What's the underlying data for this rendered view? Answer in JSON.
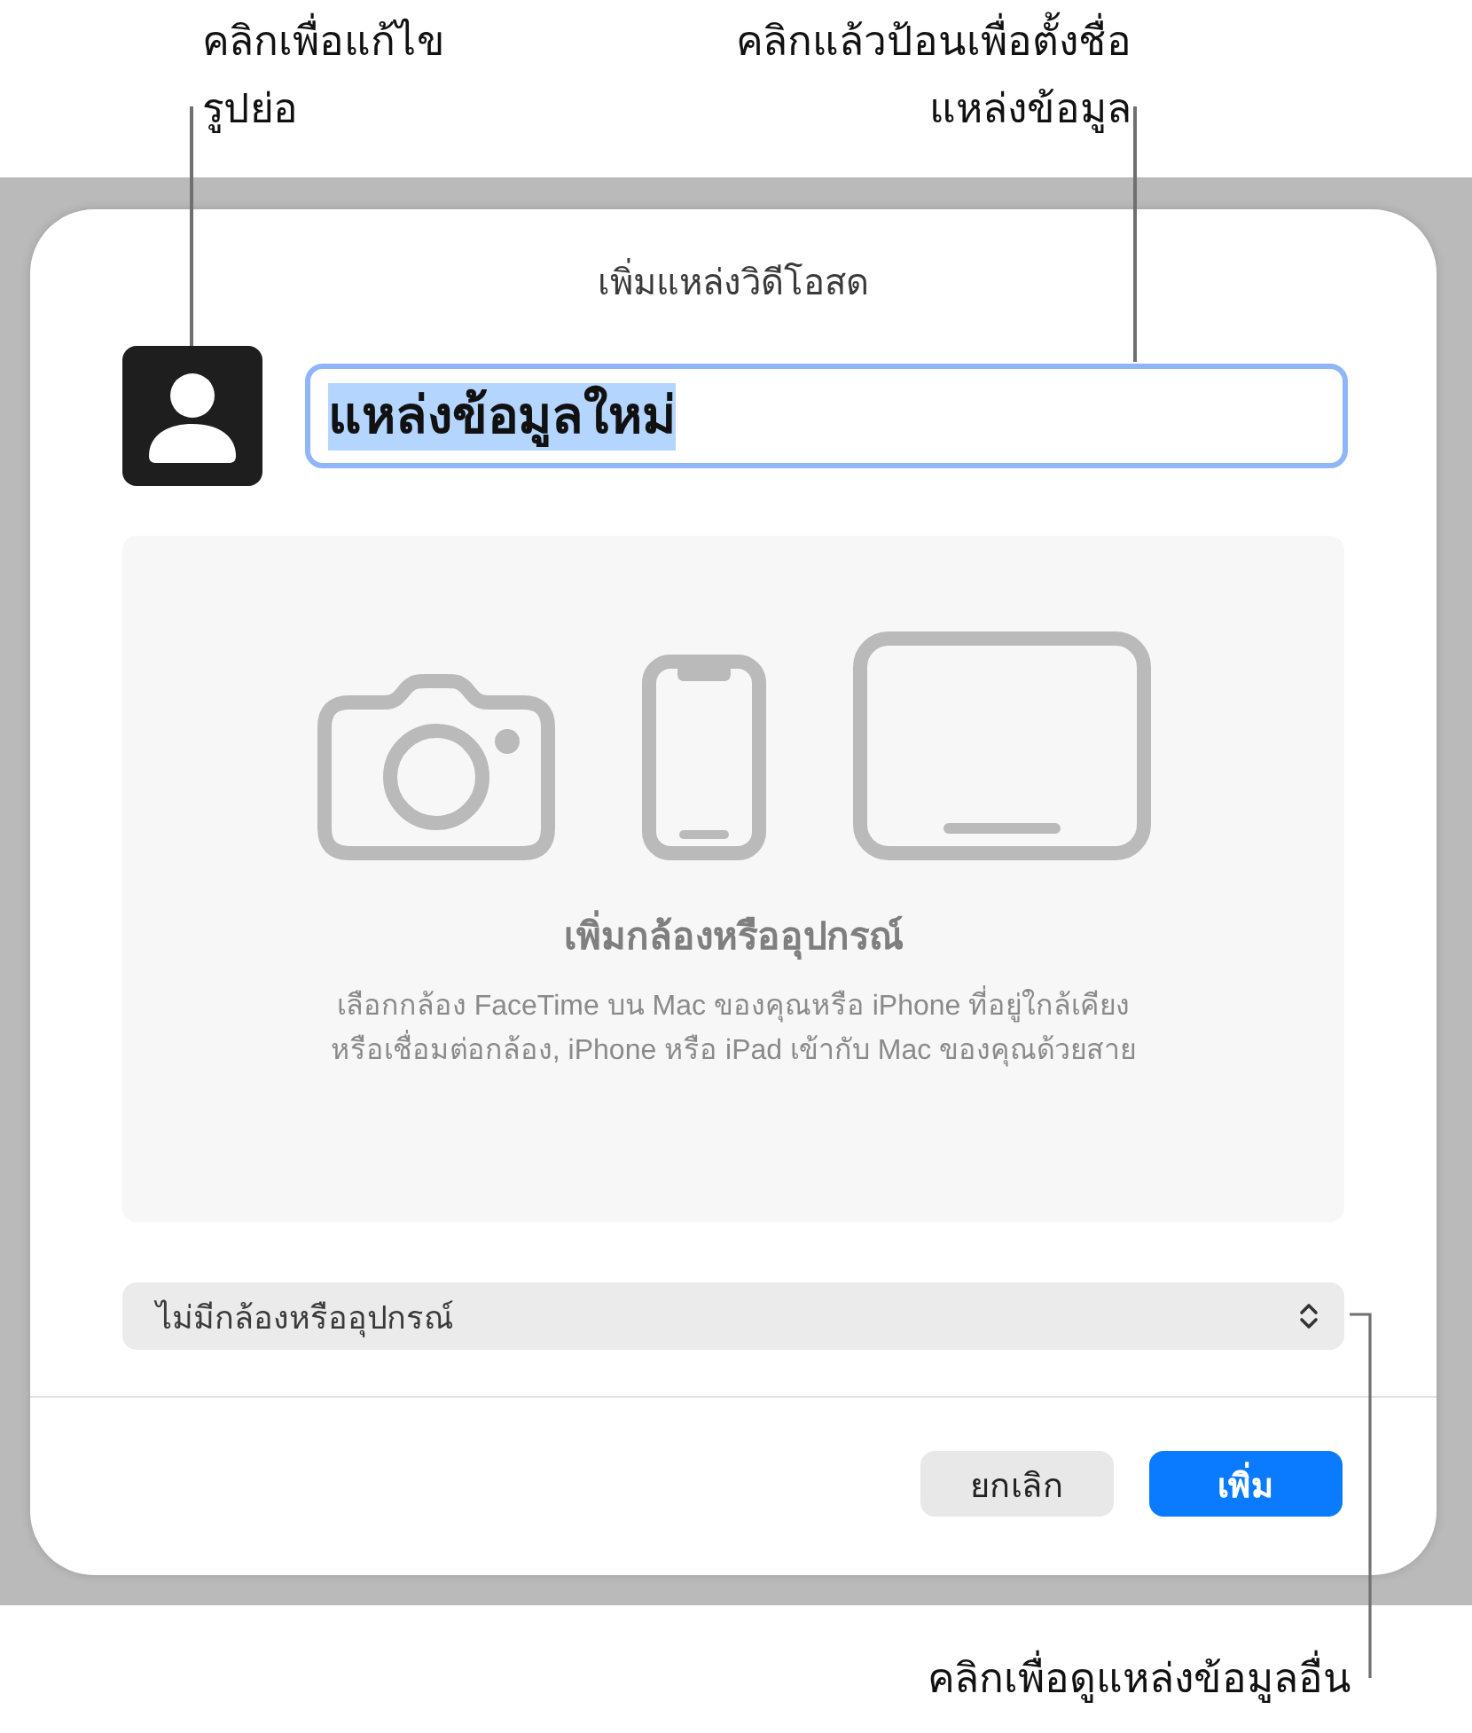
{
  "callouts": [
    {
      "text": "คลิกเพื่อแก้ไข\nรูปย่อ"
    },
    {
      "text": "คลิกแล้วป้อนเพื่อตั้งชื่อ\nแหล่งข้อมูล"
    },
    {
      "text": "คลิกเพื่อดูแหล่งข้อมูลอื่น"
    }
  ],
  "dialog": {
    "title": "เพิ่มแหล่งวิดีโอสด",
    "name_field": {
      "value": "แหล่งข้อมูลใหม่",
      "focused": true,
      "text_selected": true
    },
    "device_panel": {
      "heading": "เพิ่มกล้องหรืออุปกรณ์",
      "description": "เลือกกล้อง FaceTime บน Mac ของคุณหรือ iPhone ที่อยู่ใกล้เคียง\nหรือเชื่อมต่อกล้อง, iPhone หรือ iPad เข้ากับ Mac ของคุณด้วยสาย"
    },
    "source_popup": {
      "value": "ไม่มีกล้องหรืออุปกรณ์"
    },
    "buttons": [
      {
        "label": "ยกเลิก",
        "kind": "secondary"
      },
      {
        "label": "เพิ่ม",
        "kind": "primary"
      }
    ]
  }
}
